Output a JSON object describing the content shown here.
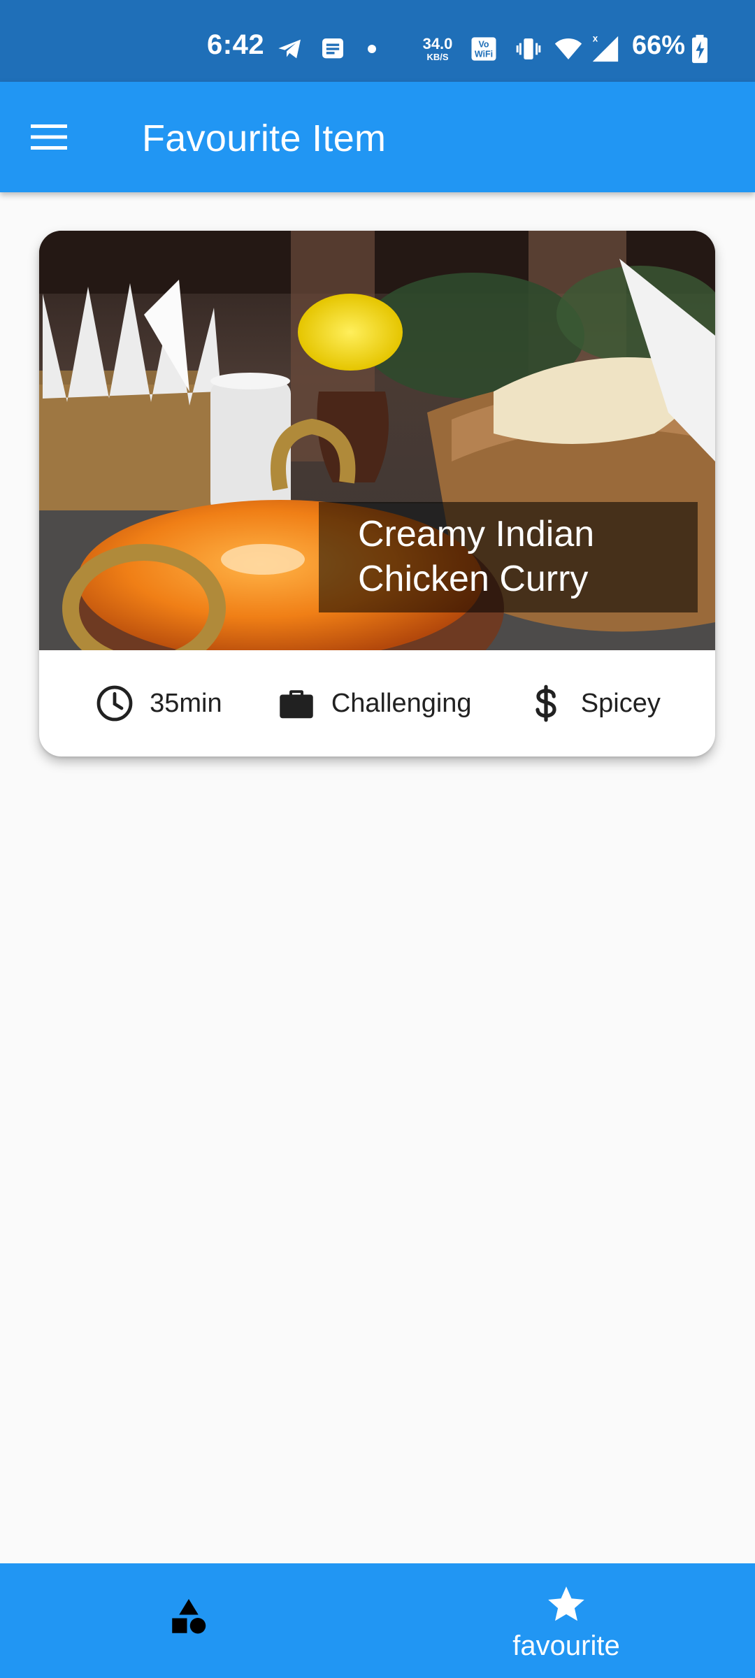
{
  "status_bar": {
    "time": "6:42",
    "net_speed_value": "34.0",
    "net_speed_unit": "KB/S",
    "battery_percent": "66%",
    "icons": [
      "telegram-icon",
      "message-icon",
      "dot-icon",
      "vowifi-icon",
      "vibrate-icon",
      "wifi-icon",
      "signal-icon",
      "battery-charging-icon"
    ]
  },
  "app_bar": {
    "title": "Favourite Item",
    "menu_icon": "hamburger-menu-icon"
  },
  "recipe_card": {
    "title": "Creamy Indian Chicken Curry",
    "duration": "35min",
    "complexity": "Challenging",
    "affordability": "Spicey",
    "icons": [
      "clock-icon",
      "briefcase-icon",
      "dollar-icon"
    ]
  },
  "bottom_nav": {
    "items": [
      {
        "icon": "categories-shapes-icon",
        "label": "",
        "selected": false
      },
      {
        "icon": "star-icon",
        "label": "favourite",
        "selected": true
      }
    ]
  },
  "colors": {
    "status_bar": "#1f6fb8",
    "primary": "#2196f3",
    "background": "#fafafa",
    "card": "#ffffff",
    "text": "#212121"
  }
}
